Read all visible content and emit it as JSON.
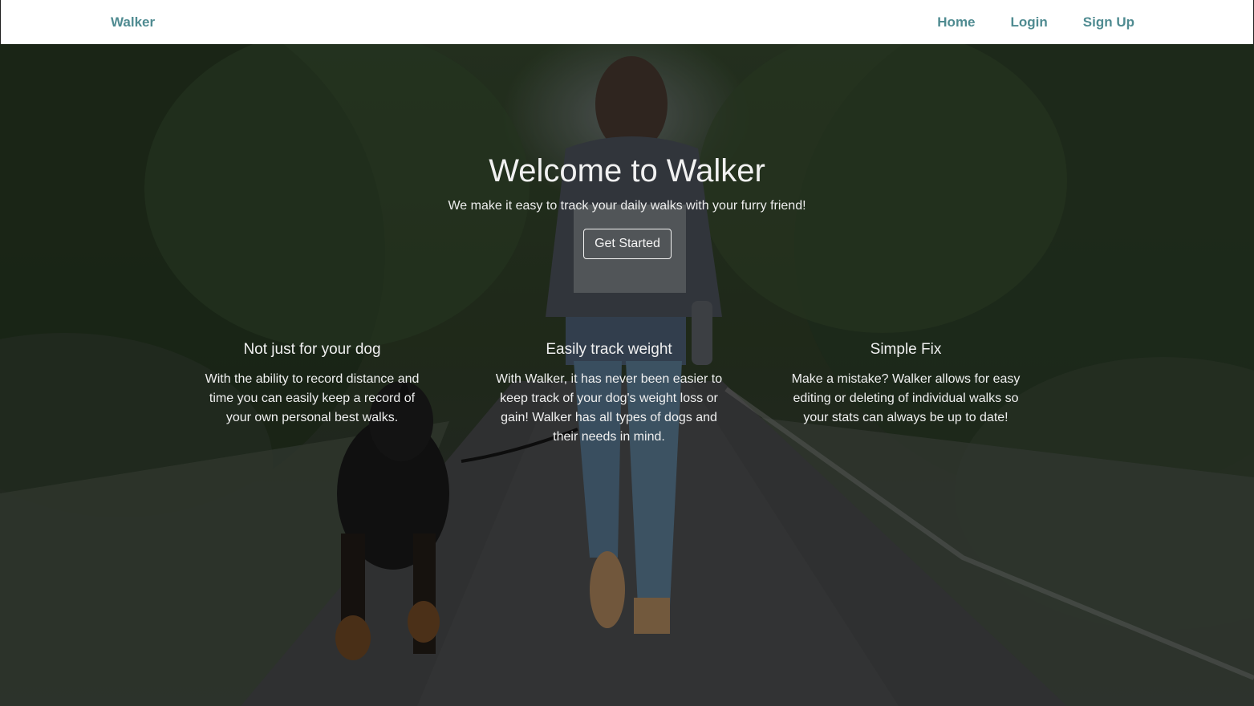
{
  "nav": {
    "brand": "Walker",
    "links": [
      "Home",
      "Login",
      "Sign Up"
    ]
  },
  "hero": {
    "title": "Welcome to Walker",
    "subtitle": "We make it easy to track your daily walks with your furry friend!",
    "cta_label": "Get Started"
  },
  "features": [
    {
      "title": "Not just for your dog",
      "text": "With the ability to record distance and time you can easily keep a record of your own personal best walks."
    },
    {
      "title": "Easily track weight",
      "text": "With Walker, it has never been easier to keep track of your dog's weight loss or gain! Walker has all types of dogs and their needs in mind."
    },
    {
      "title": "Simple Fix",
      "text": "Make a mistake? Walker allows for easy editing or deleting of individual walks so your stats can always be up to date!"
    }
  ],
  "colors": {
    "accent": "#4f8b91",
    "navbar_bg": "#ffffff",
    "hero_text": "#f1f1f1"
  }
}
